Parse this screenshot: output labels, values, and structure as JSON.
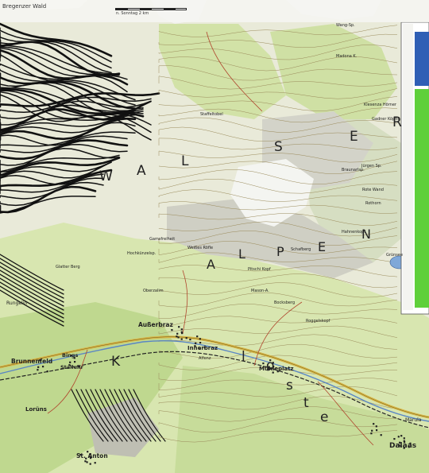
{
  "map": {
    "header": {
      "title": "Bregenzer Wald",
      "scale_note": "n. Sonntag 2 km"
    },
    "range_labels": [
      {
        "key": "walser-letter-1",
        "text": "W"
      },
      {
        "key": "walser-letter-2",
        "text": "A"
      },
      {
        "key": "walser-letter-3",
        "text": "L"
      },
      {
        "key": "walser-letter-4",
        "text": "S"
      },
      {
        "key": "walser-letter-5",
        "text": "E"
      },
      {
        "key": "walser-letter-6",
        "text": "R"
      },
      {
        "key": "alpen-letter-1",
        "text": "A"
      },
      {
        "key": "alpen-letter-2",
        "text": "L"
      },
      {
        "key": "alpen-letter-3",
        "text": "P"
      },
      {
        "key": "alpen-letter-4",
        "text": "E"
      },
      {
        "key": "alpen-letter-5",
        "text": "N"
      },
      {
        "key": "kloster-letter-1",
        "text": "K"
      },
      {
        "key": "kloster-letter-2",
        "text": "l"
      },
      {
        "key": "kloster-letter-3",
        "text": "o"
      },
      {
        "key": "kloster-letter-4",
        "text": "s"
      },
      {
        "key": "kloster-letter-5",
        "text": "t"
      },
      {
        "key": "kloster-letter-6",
        "text": "e"
      }
    ],
    "places": [
      {
        "key": "aussberbraz",
        "text": "Außerbraz"
      },
      {
        "key": "innerbraz",
        "text": "Innerbraz"
      },
      {
        "key": "muehleplatz",
        "text": "Mühleplatz"
      },
      {
        "key": "brunnenfeld",
        "text": "Brunnenfeld"
      },
      {
        "key": "bings",
        "text": "Bings"
      },
      {
        "key": "stallehr",
        "text": "Stallehr"
      },
      {
        "key": "loruens",
        "text": "Lorüns"
      },
      {
        "key": "st-anton",
        "text": "St. Anton"
      },
      {
        "key": "rungelin",
        "text": "Rungelin"
      },
      {
        "key": "dalaas",
        "text": "Dalaas"
      },
      {
        "key": "marula",
        "text": "Marula"
      }
    ],
    "features": [
      {
        "key": "braunarlsp",
        "text": "Braunarlsp."
      },
      {
        "key": "rote-wand",
        "text": "Rote Wand"
      },
      {
        "key": "schafberg",
        "text": "Schafberg"
      },
      {
        "key": "pitschi-kopf",
        "text": "Pitschi Kopf"
      },
      {
        "key": "gamsfreiheit",
        "text": "Gamsfreiheit"
      },
      {
        "key": "weisse-roefle",
        "text": "Weißes Röfle"
      },
      {
        "key": "hochkuenzelspitze",
        "text": "Hochkünzelsp."
      },
      {
        "key": "glatter-berg",
        "text": "Glatter Berg"
      },
      {
        "key": "klesenza",
        "text": "Klesenza Hörner"
      },
      {
        "key": "gadner-koepfle",
        "text": "Gadner Köpfle"
      },
      {
        "key": "bocksberg",
        "text": "Bocksberg"
      },
      {
        "key": "roggelskopf",
        "text": "Roggelskopf"
      },
      {
        "key": "staffeltobel",
        "text": "Staffeltobel"
      },
      {
        "key": "mason-a",
        "text": "Mason-A."
      },
      {
        "key": "hahnenkopf",
        "text": "Hahnenkopf"
      },
      {
        "key": "wang-sp",
        "text": "Wang-Sp."
      },
      {
        "key": "madona",
        "text": "Madona K."
      },
      {
        "key": "rothorn",
        "text": "Rothorn"
      },
      {
        "key": "juergen-sp",
        "text": "Jürgen Sp."
      },
      {
        "key": "oberzalim",
        "text": "Oberzalim"
      },
      {
        "key": "alfenz",
        "text": "Alfenz"
      },
      {
        "key": "gruensee",
        "text": "Grünsee"
      }
    ],
    "panel": {
      "accent": "#5fd03a",
      "blue": "#2f5fb5"
    },
    "colors": {
      "paper": "#e9ead9",
      "meadow": "#cfe0a4",
      "forest": "#8fb96c",
      "rock": "#c9c9bf",
      "water": "#7fa8d8",
      "road": "#d8b645",
      "rail": "#222222",
      "contour": "#111111"
    }
  }
}
